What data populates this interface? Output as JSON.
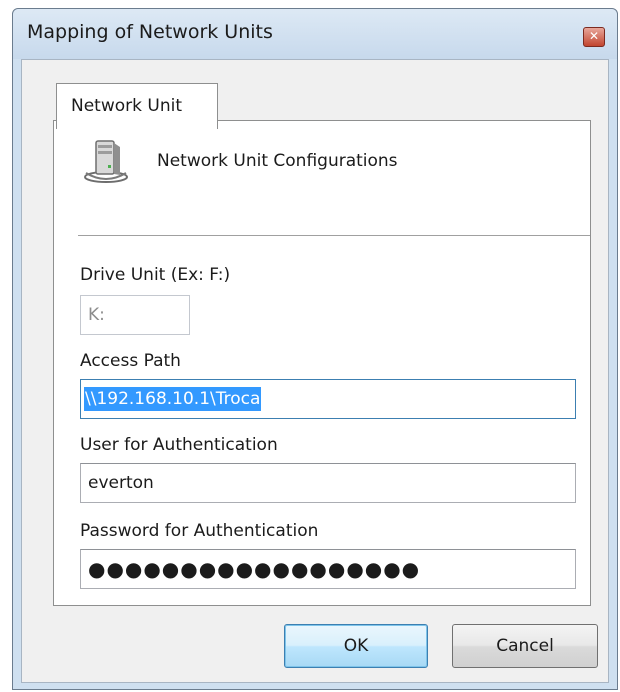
{
  "window": {
    "title": "Mapping of Network Units",
    "close_glyph": "✕"
  },
  "tabs": [
    {
      "label": "Network Unit",
      "active": true
    }
  ],
  "panel": {
    "icon": "network-server-icon",
    "heading": "Network Unit Configurations"
  },
  "form": {
    "drive_unit": {
      "label": "Drive Unit (Ex: F:)",
      "value": "K:",
      "enabled": false
    },
    "access_path": {
      "label": "Access Path",
      "value": "\\\\192.168.10.1\\Troca",
      "selected": true
    },
    "user": {
      "label": "User for Authentication",
      "value": "everton"
    },
    "password": {
      "label": "Password for Authentication",
      "value": "●●●●●●●●●●●●●●●●●●"
    }
  },
  "buttons": {
    "ok_label": "OK",
    "cancel_label": "Cancel"
  },
  "colors": {
    "frame": "#cfe0f0",
    "selection": "#3399ff",
    "default_button": "#bee6fd"
  }
}
